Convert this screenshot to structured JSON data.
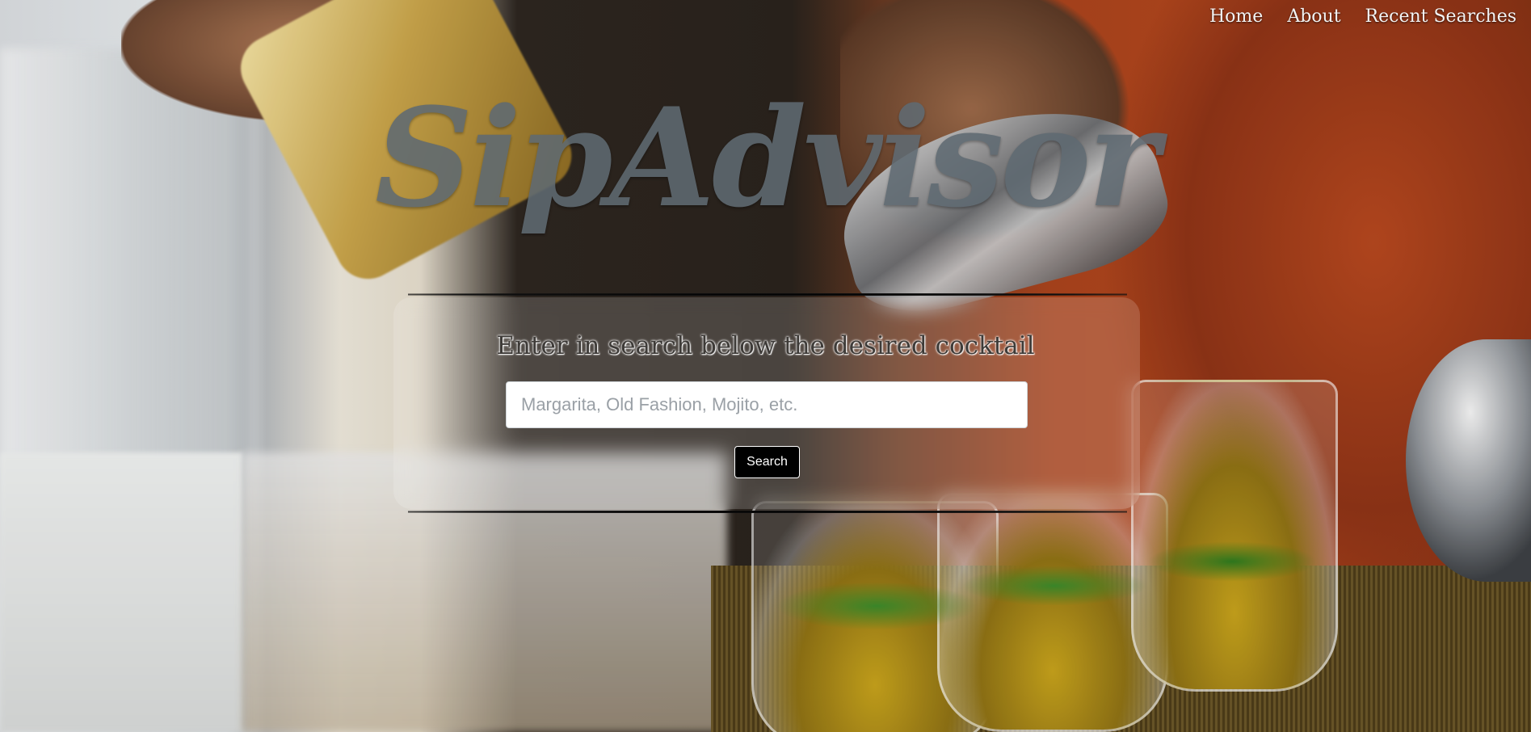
{
  "nav": {
    "items": [
      {
        "label": "Home"
      },
      {
        "label": "About"
      },
      {
        "label": "Recent Searches"
      }
    ]
  },
  "brand": {
    "title": "SipAdvisor"
  },
  "search": {
    "prompt": "Enter in search below the desired cocktail",
    "placeholder": "Margarita, Old Fashion, Mojito, etc.",
    "value": "",
    "button_label": "Search"
  }
}
